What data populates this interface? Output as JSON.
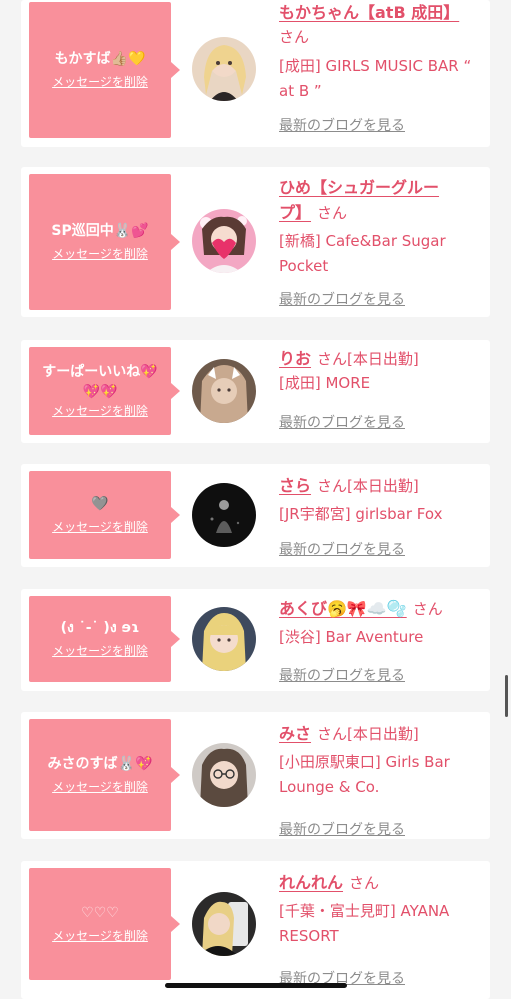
{
  "cards": [
    {
      "message": "もかすば👍🏼💛",
      "delete_label": "メッセージを削除",
      "name": "もかちゃん【atB 成田】",
      "honorific": "さん",
      "attendance": "",
      "shop": "[成田] GIRLS MUSIC BAR “ at B ”",
      "blog_label": "最新のブログを見る"
    },
    {
      "message": "SP巡回中🐰💕",
      "delete_label": "メッセージを削除",
      "name": "ひめ【シュガーグループ】",
      "honorific": "さん",
      "attendance": "",
      "shop": "[新橋] Cafe&Bar Sugar Pocket",
      "blog_label": "最新のブログを見る"
    },
    {
      "message": "すーぱーいいね💖💖💖",
      "delete_label": "メッセージを削除",
      "name": "りお",
      "honorific": "さん",
      "attendance": "[本日出勤]",
      "shop": "[成田] MORE",
      "blog_label": "最新のブログを見る"
    },
    {
      "message": "🩶",
      "delete_label": "メッセージを削除",
      "name": "さら",
      "honorific": "さん",
      "attendance": "[本日出勤]",
      "shop": "[JR宇都宮] girlsbar Fox",
      "blog_label": "最新のブログを見る"
    },
    {
      "message": "(ง ˙-˙ )ง ɘɿ",
      "delete_label": "メッセージを削除",
      "name": "あくび🥱🎀☁️🫧",
      "honorific": "さん",
      "attendance": "",
      "shop": "[渋谷] Bar Aventure",
      "blog_label": "最新のブログを見る"
    },
    {
      "message": "みさのすば🐰💖",
      "delete_label": "メッセージを削除",
      "name": "みさ",
      "honorific": "さん",
      "attendance": "[本日出勤]",
      "shop": "[小田原駅東口] Girls Bar Lounge & Co.",
      "blog_label": "最新のブログを見る"
    },
    {
      "message": "♡♡♡",
      "delete_label": "メッセージを削除",
      "name": "れんれん",
      "honorific": "さん",
      "attendance": "",
      "shop": "[千葉・富士見町] AYANA RESORT",
      "blog_label": "最新のブログを見る"
    }
  ],
  "colors": {
    "bubble": "#f9909b",
    "accent": "#e2506a",
    "blog_link": "#8c8c8c",
    "background": "#f4f4f4"
  }
}
